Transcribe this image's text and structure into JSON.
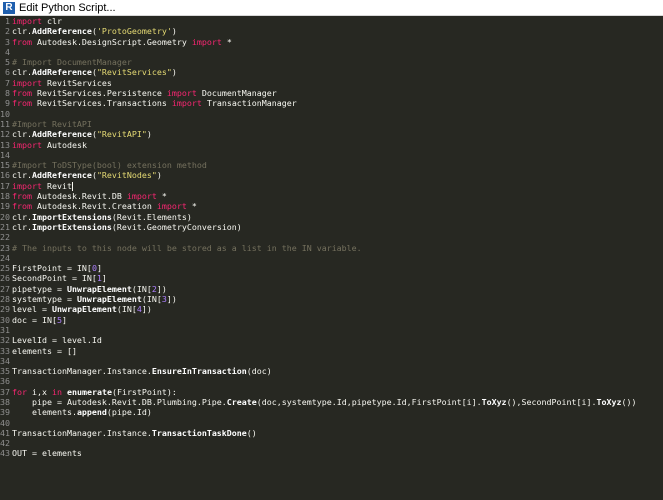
{
  "window": {
    "title": "Edit Python Script...",
    "icon_letter": "R"
  },
  "colors": {
    "background": "#272822",
    "keyword": "#f92672",
    "string": "#e6db74",
    "comment": "#75715e",
    "number": "#ae81ff",
    "text": "#f8f8f2"
  },
  "lines": [
    [
      [
        "kw",
        "import"
      ],
      [
        "t",
        " clr"
      ]
    ],
    [
      [
        "t",
        "clr."
      ],
      [
        "fn",
        "AddReference"
      ],
      [
        "t",
        "("
      ],
      [
        "str",
        "'ProtoGeometry'"
      ],
      [
        "t",
        ")"
      ]
    ],
    [
      [
        "kw",
        "from"
      ],
      [
        "t",
        " Autodesk.DesignScript.Geometry "
      ],
      [
        "kw",
        "import"
      ],
      [
        "t",
        " *"
      ]
    ],
    [],
    [
      [
        "cm",
        "# Import DocumentManager"
      ]
    ],
    [
      [
        "t",
        "clr."
      ],
      [
        "fn",
        "AddReference"
      ],
      [
        "t",
        "("
      ],
      [
        "str",
        "\"RevitServices\""
      ],
      [
        "t",
        ")"
      ]
    ],
    [
      [
        "kw",
        "import"
      ],
      [
        "t",
        " RevitServices"
      ]
    ],
    [
      [
        "kw",
        "from"
      ],
      [
        "t",
        " RevitServices.Persistence "
      ],
      [
        "kw",
        "import"
      ],
      [
        "t",
        " DocumentManager"
      ]
    ],
    [
      [
        "kw",
        "from"
      ],
      [
        "t",
        " RevitServices.Transactions "
      ],
      [
        "kw",
        "import"
      ],
      [
        "t",
        " TransactionManager"
      ]
    ],
    [],
    [
      [
        "cm",
        "#Import RevitAPI"
      ]
    ],
    [
      [
        "t",
        "clr."
      ],
      [
        "fn",
        "AddReference"
      ],
      [
        "t",
        "("
      ],
      [
        "str",
        "\"RevitAPI\""
      ],
      [
        "t",
        ")"
      ]
    ],
    [
      [
        "kw",
        "import"
      ],
      [
        "t",
        " Autodesk"
      ]
    ],
    [],
    [
      [
        "cm",
        "#Import ToDSType(bool) extension method"
      ]
    ],
    [
      [
        "t",
        "clr."
      ],
      [
        "fn",
        "AddReference"
      ],
      [
        "t",
        "("
      ],
      [
        "str",
        "\"RevitNodes\""
      ],
      [
        "t",
        ")"
      ]
    ],
    [
      [
        "kw",
        "import"
      ],
      [
        "t",
        " Revit"
      ],
      [
        "caret",
        ""
      ]
    ],
    [
      [
        "kw",
        "from"
      ],
      [
        "t",
        " Autodesk.Revit.DB "
      ],
      [
        "kw",
        "import"
      ],
      [
        "t",
        " *"
      ]
    ],
    [
      [
        "kw",
        "from"
      ],
      [
        "t",
        " Autodesk.Revit.Creation "
      ],
      [
        "kw",
        "import"
      ],
      [
        "t",
        " *"
      ]
    ],
    [
      [
        "t",
        "clr."
      ],
      [
        "fn",
        "ImportExtensions"
      ],
      [
        "t",
        "(Revit.Elements)"
      ]
    ],
    [
      [
        "t",
        "clr."
      ],
      [
        "fn",
        "ImportExtensions"
      ],
      [
        "t",
        "(Revit.GeometryConversion)"
      ]
    ],
    [],
    [
      [
        "cm",
        "# The inputs to this node will be stored as a list in the IN variable."
      ]
    ],
    [],
    [
      [
        "t",
        "FirstPoint = IN["
      ],
      [
        "num",
        "0"
      ],
      [
        "t",
        "]"
      ]
    ],
    [
      [
        "t",
        "SecondPoint = IN["
      ],
      [
        "num",
        "1"
      ],
      [
        "t",
        "]"
      ]
    ],
    [
      [
        "t",
        "pipetype = "
      ],
      [
        "fn",
        "UnwrapElement"
      ],
      [
        "t",
        "(IN["
      ],
      [
        "num",
        "2"
      ],
      [
        "t",
        "])"
      ]
    ],
    [
      [
        "t",
        "systemtype = "
      ],
      [
        "fn",
        "UnwrapElement"
      ],
      [
        "t",
        "(IN["
      ],
      [
        "num",
        "3"
      ],
      [
        "t",
        "])"
      ]
    ],
    [
      [
        "t",
        "level = "
      ],
      [
        "fn",
        "UnwrapElement"
      ],
      [
        "t",
        "(IN["
      ],
      [
        "num",
        "4"
      ],
      [
        "t",
        "])"
      ]
    ],
    [
      [
        "t",
        "doc = IN["
      ],
      [
        "num",
        "5"
      ],
      [
        "t",
        "]"
      ]
    ],
    [],
    [
      [
        "t",
        "LevelId = level.Id"
      ]
    ],
    [
      [
        "t",
        "elements = []"
      ]
    ],
    [],
    [
      [
        "t",
        "TransactionManager.Instance."
      ],
      [
        "fn",
        "EnsureInTransaction"
      ],
      [
        "t",
        "(doc)"
      ]
    ],
    [],
    [
      [
        "kw",
        "for"
      ],
      [
        "t",
        " i,x "
      ],
      [
        "kw",
        "in"
      ],
      [
        "t",
        " "
      ],
      [
        "fn",
        "enumerate"
      ],
      [
        "t",
        "(FirstPoint):"
      ]
    ],
    [
      [
        "t",
        "    pipe = Autodesk.Revit.DB.Plumbing.Pipe."
      ],
      [
        "fn",
        "Create"
      ],
      [
        "t",
        "(doc,systemtype.Id,pipetype.Id,FirstPoint[i]."
      ],
      [
        "fn",
        "ToXyz"
      ],
      [
        "t",
        "(),SecondPoint[i]."
      ],
      [
        "fn",
        "ToXyz"
      ],
      [
        "t",
        "())"
      ]
    ],
    [
      [
        "t",
        "    elements."
      ],
      [
        "fn",
        "append"
      ],
      [
        "t",
        "(pipe.Id)"
      ]
    ],
    [],
    [
      [
        "t",
        "TransactionManager.Instance."
      ],
      [
        "fn",
        "TransactionTaskDone"
      ],
      [
        "t",
        "()"
      ]
    ],
    [],
    [
      [
        "t",
        "OUT = elements"
      ]
    ]
  ]
}
